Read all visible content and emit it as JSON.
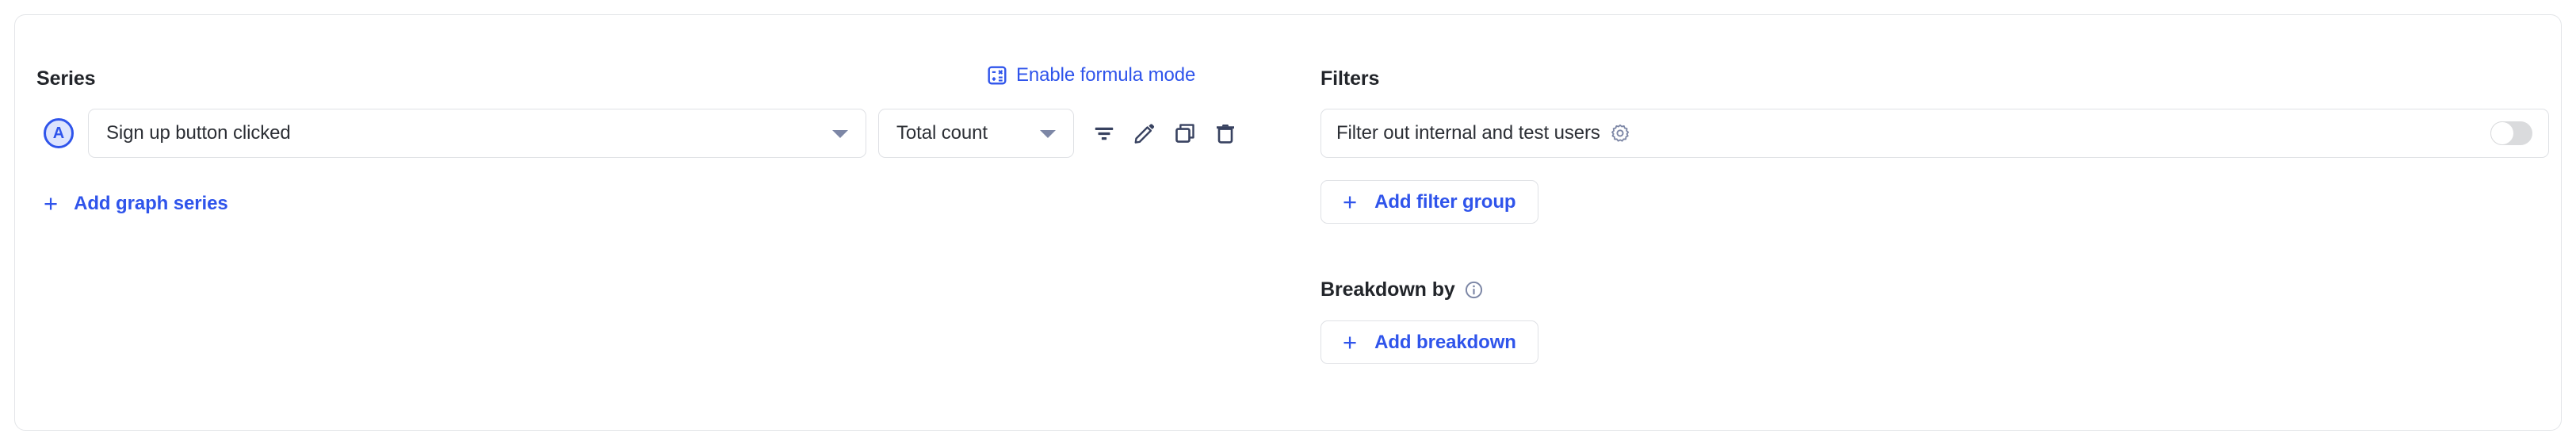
{
  "series": {
    "title": "Series",
    "formula_mode": {
      "label": "Enable formula mode",
      "icon": "calculator-icon",
      "color": "#2f54eb"
    },
    "rows": [
      {
        "badge": "A",
        "event": "Sign up button clicked",
        "math": "Total count",
        "actions": [
          "filter-icon",
          "edit-pencil-icon",
          "duplicate-icon",
          "delete-trash-icon"
        ]
      }
    ],
    "add_series": {
      "plus": "+",
      "label": "Add graph series"
    }
  },
  "filters": {
    "title": "Filters",
    "rows": [
      {
        "label": "Filter out internal and test users",
        "gear": "gear-icon",
        "toggle_on": false
      }
    ],
    "add_filter_group": {
      "plus": "+",
      "label": "Add filter group"
    }
  },
  "breakdown": {
    "title": "Breakdown by",
    "info": "info-icon",
    "add_breakdown": {
      "plus": "+",
      "label": "Add breakdown"
    }
  },
  "colors": {
    "accent": "#2f54eb",
    "badge_fill": "#dde4fd",
    "icon_dark": "#384260",
    "icon_muted": "#7d87a6",
    "border": "#dfe1e5",
    "text": "#2c2f35",
    "toggle_off": "#dadbdd"
  }
}
